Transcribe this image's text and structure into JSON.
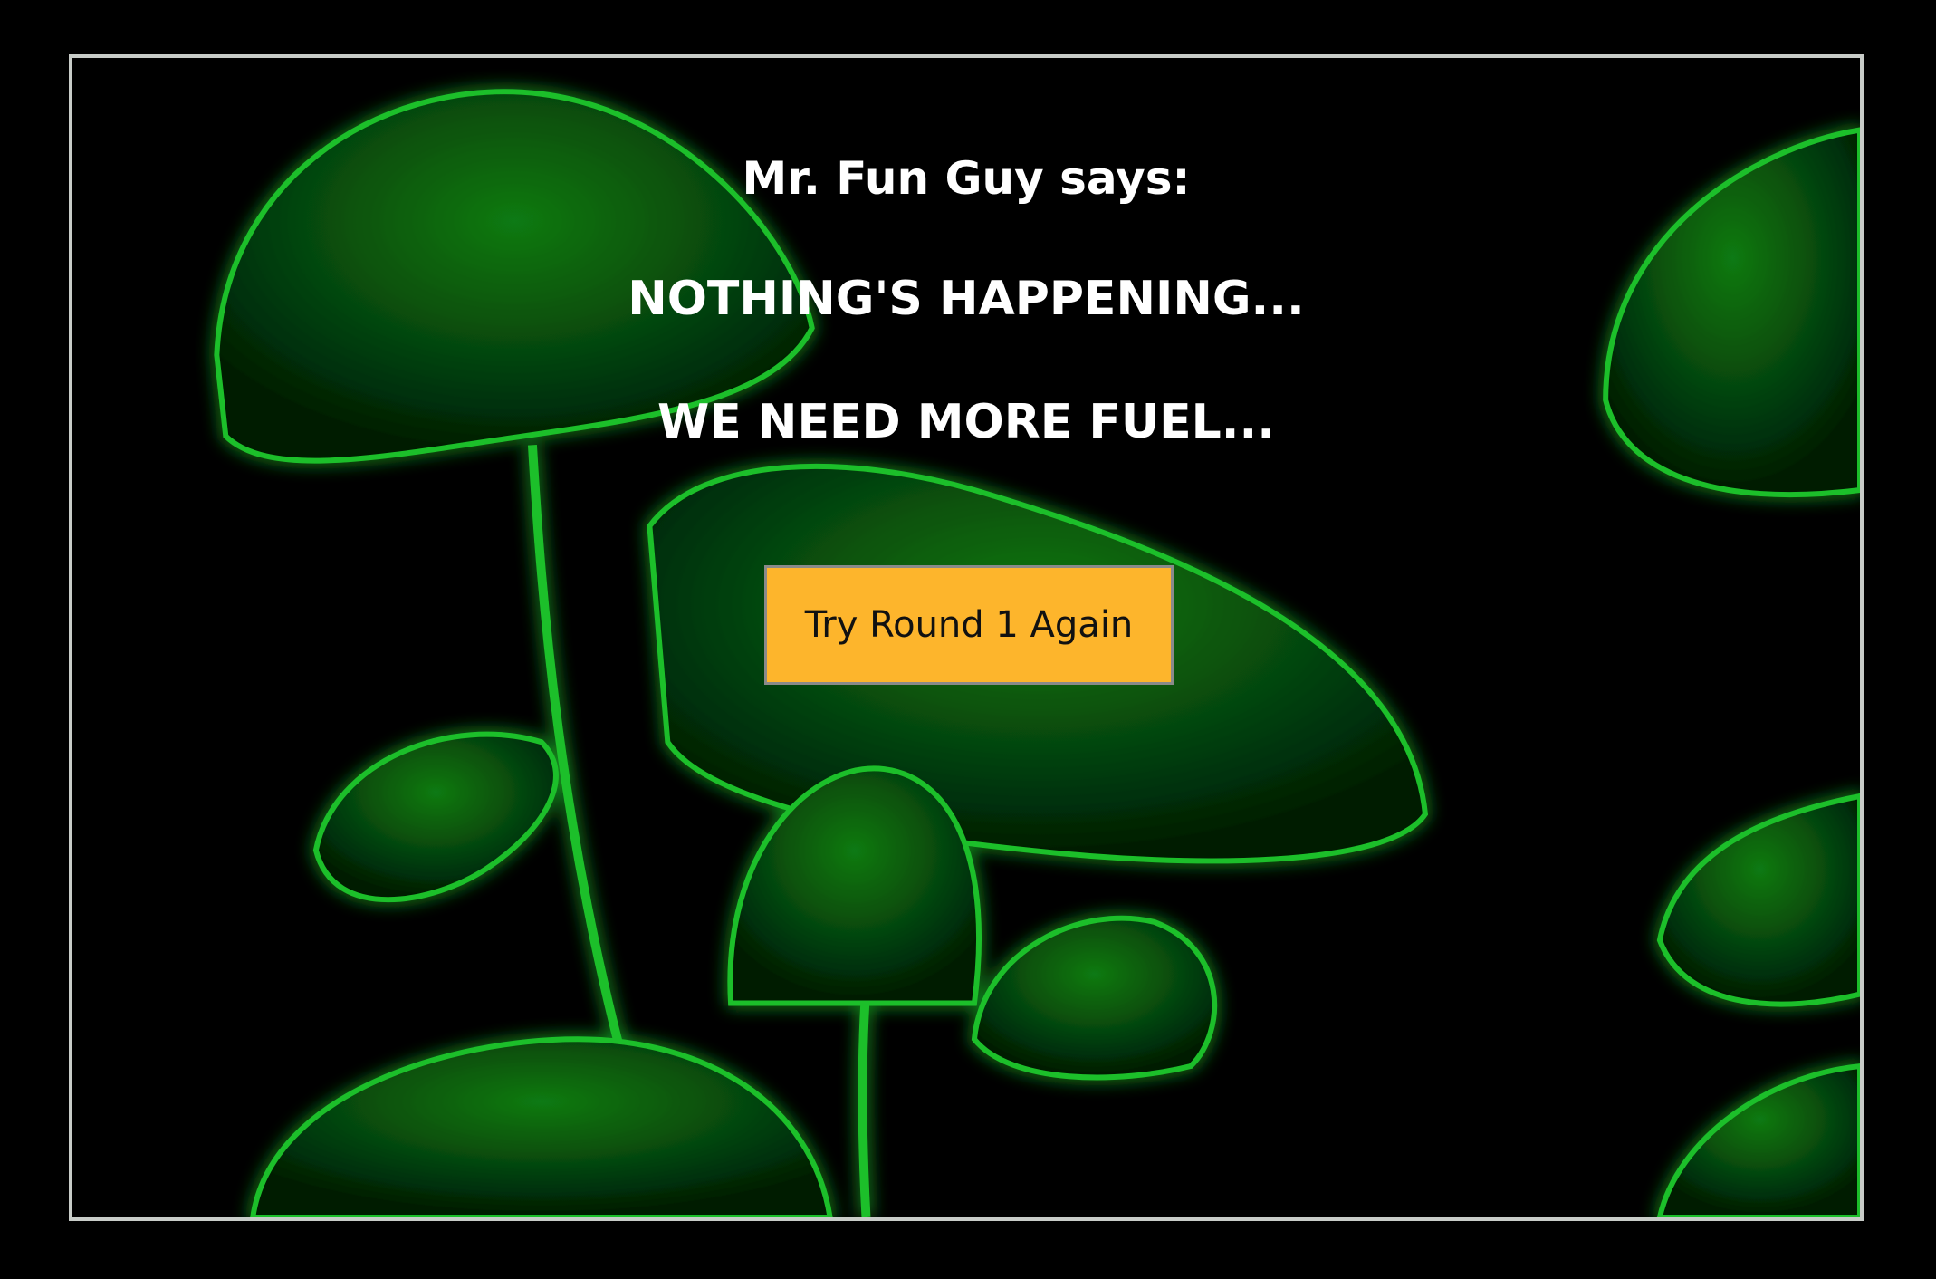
{
  "scene": {
    "speaker_label": "Mr. Fun Guy says:",
    "message_line_1": "NOTHING'S HAPPENING...",
    "message_line_2": "WE NEED MORE FUEL...",
    "background_icon": "glowing-mushrooms-illustration"
  },
  "actions": {
    "retry_label": "Try Round 1 Again"
  },
  "colors": {
    "page_background": "#000000",
    "frame_border": "#c8ccc8",
    "button_fill": "#fdb52c",
    "mushroom_glow": "#1fbf2a",
    "text": "#ffffff"
  }
}
